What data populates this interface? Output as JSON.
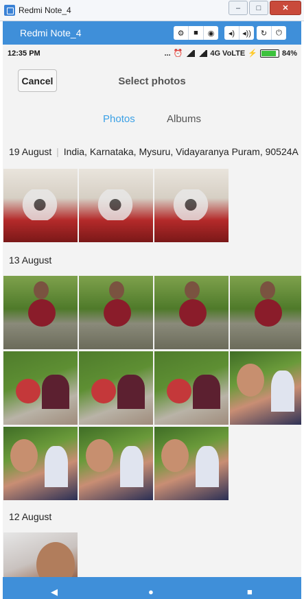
{
  "window": {
    "title": "Redmi Note_4",
    "minimize_glyph": "–",
    "maximize_glyph": "□",
    "close_glyph": "✕"
  },
  "toolbar": {
    "title": "Redmi Note_4",
    "icons": [
      "gear-icon",
      "video-icon",
      "camera-icon",
      "volume-down-icon",
      "volume-up-icon",
      "rotate-icon",
      "power-icon"
    ],
    "glyphs": {
      "gear": "⚙",
      "video": "■",
      "camera": "◉",
      "vol_down": "◂)",
      "vol_up": "◂))",
      "rotate": "↻",
      "power": "⏻"
    }
  },
  "status_bar": {
    "time": "12:35 PM",
    "dots": "...",
    "network": "4G VoLTE",
    "battery": "84%"
  },
  "header": {
    "cancel_label": "Cancel",
    "title": "Select photos"
  },
  "tabs": [
    {
      "label": "Photos",
      "active": true
    },
    {
      "label": "Albums",
      "active": false
    }
  ],
  "sections": [
    {
      "date": "19 August",
      "location": "India, Karnataka, Mysuru, Vidayaranya Puram, 90524A"
    },
    {
      "date": "13 August"
    },
    {
      "date": "12 August"
    }
  ],
  "colors": {
    "accent": "#3aa0e6",
    "toolbar_blue": "#3f8fd9",
    "background": "#f3f3f3"
  }
}
